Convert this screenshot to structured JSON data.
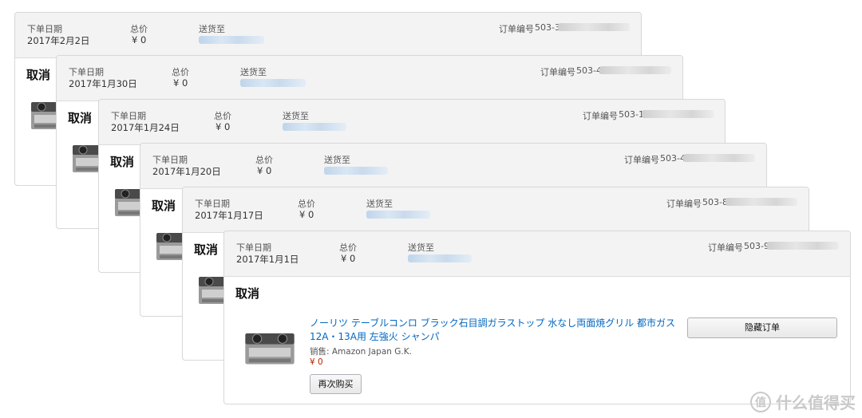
{
  "labels": {
    "date": "下单日期",
    "total": "总价",
    "ship_to": "送货至",
    "order_number": "订单编号",
    "status": "取消"
  },
  "orders": [
    {
      "date": "2017年2月2日",
      "total": "¥ 0",
      "order_prefix": "503-3"
    },
    {
      "date": "2017年1月30日",
      "total": "¥ 0",
      "order_prefix": "503-4"
    },
    {
      "date": "2017年1月24日",
      "total": "¥ 0",
      "order_prefix": "503-1"
    },
    {
      "date": "2017年1月20日",
      "total": "¥ 0",
      "order_prefix": "503-4"
    },
    {
      "date": "2017年1月17日",
      "total": "¥ 0",
      "order_prefix": "503-8"
    },
    {
      "date": "2017年1月1日",
      "total": "¥ 0",
      "order_prefix": "503-9"
    }
  ],
  "product": {
    "title_line1": "ノーリツ テーブルコンロ ブラック石目調ガラストップ 水なし両面焼グリル 都市ガス",
    "title_line2": "12A・13A用 左強火 シャンパ",
    "seller": "销售: Amazon Japan G.K.",
    "price": "¥ 0",
    "buy_again_label": "再次购买",
    "hide_order_label": "隐藏订单"
  },
  "watermark": {
    "glyph": "值",
    "text": "什么值得买"
  },
  "icons": [
    "gas-stove-icon",
    "zhi-logo-icon"
  ]
}
